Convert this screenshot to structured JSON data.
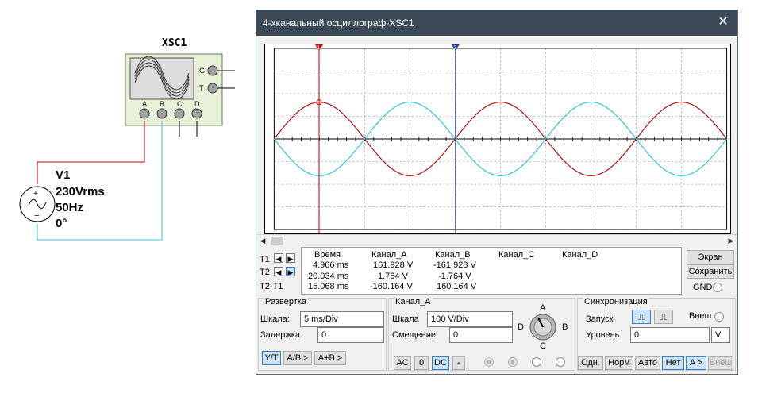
{
  "schematic": {
    "xsc_label": "XSC1",
    "xsc_left_pins": [
      "A",
      "B",
      "C",
      "D"
    ],
    "xsc_right_pins": [
      "G",
      "T"
    ],
    "source_name": "V1",
    "source_voltage": "230Vrms",
    "source_freq": "50Hz",
    "source_phase": "0°",
    "wire_a_color": "#cc0000",
    "wire_b_color": "#33ccdd"
  },
  "window": {
    "title": "4-хканальный осциллограф-XSC1",
    "close_glyph": "✕"
  },
  "screen": {
    "channel_a_color": "#b01010",
    "channel_b_color": "#30c8d8",
    "cursor1_color": "#cc0000",
    "cursor2_color": "#2040b0",
    "cursor1_label": "1",
    "cursor2_label": "2"
  },
  "readout": {
    "headers": [
      "Время",
      "Канал_A",
      "Канал_B",
      "Канал_C",
      "Канал_D"
    ],
    "row_labels": [
      "T1",
      "T2",
      "T2-T1"
    ],
    "rows": [
      [
        "4.966 ms",
        "161.928 V",
        "-161.928 V"
      ],
      [
        "20.034 ms",
        "1.764 V",
        "-1.764 V"
      ],
      [
        "15.068 ms",
        "-160.164 V",
        "160.164 V"
      ]
    ]
  },
  "right_panel": {
    "screen_btn": "Экран",
    "save_btn": "Сохранить",
    "gnd_label": "GND"
  },
  "sweep": {
    "title": "Развертка",
    "scale_label": "Шкала:",
    "scale_value": "5 ms/Div",
    "delay_label": "Задержка",
    "delay_value": "0",
    "btn_yt": "Y/T",
    "btn_ab": "A/B >",
    "btn_apb": "A+B >"
  },
  "channel": {
    "title": "Канал_A",
    "scale_label": "Шкала",
    "scale_value": "100  V/Div",
    "offset_label": "Смещение",
    "offset_value": "0",
    "btn_ac": "AC",
    "btn_zero": "0",
    "btn_dc": "DC",
    "btn_minus": "-",
    "knob_labels": [
      "A",
      "B",
      "C",
      "D"
    ]
  },
  "trigger": {
    "title": "Синхронизация",
    "start_label": "Запуск",
    "ext_label": "Внеш",
    "level_label": "Уровень",
    "level_value": "0",
    "level_unit": "V",
    "btn_single": "Одн.",
    "btn_norm": "Норм",
    "btn_auto": "Авто",
    "btn_none": "Нет",
    "btn_a": "A >",
    "btn_ext": "Внеш"
  }
}
